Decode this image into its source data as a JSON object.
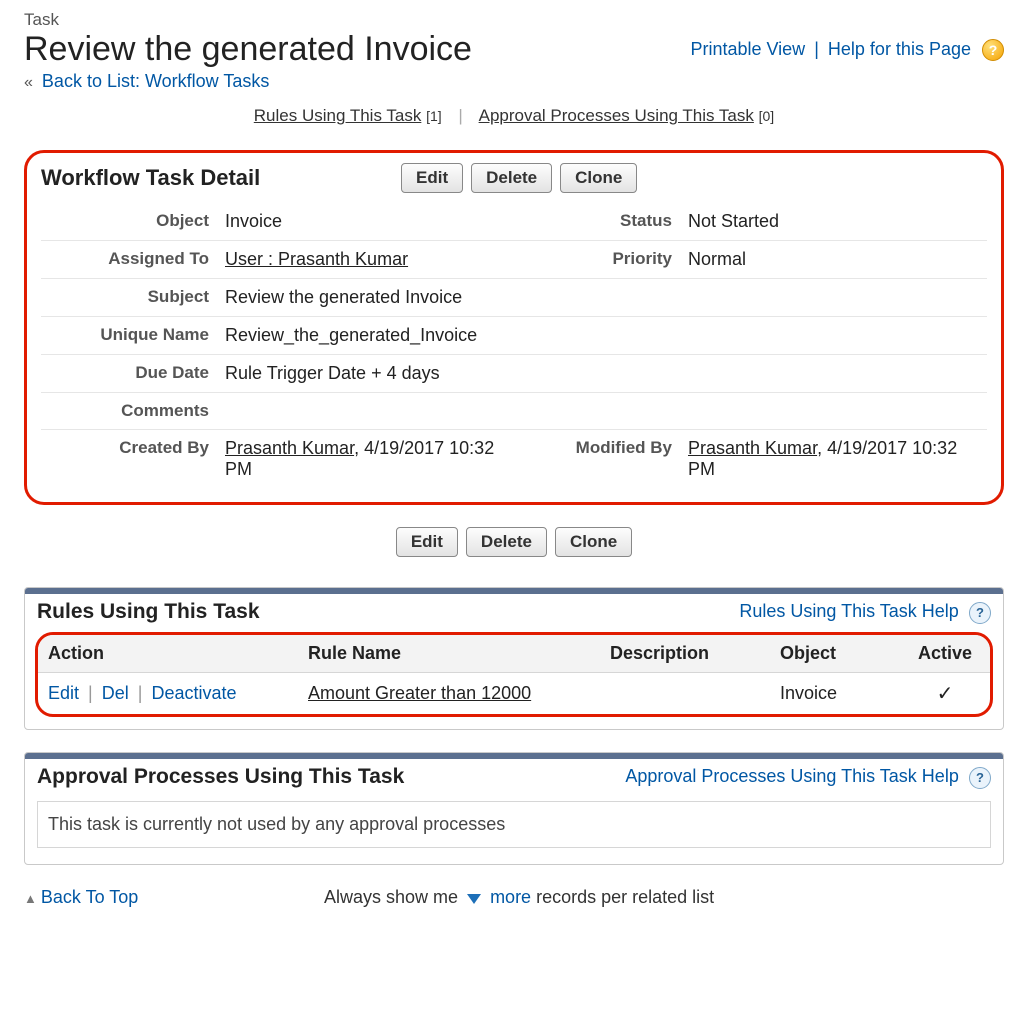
{
  "breadcrumb": {
    "label": "Task"
  },
  "page_title": "Review the generated Invoice",
  "top_links": {
    "printable": "Printable View",
    "help": "Help for this Page"
  },
  "back_link": {
    "text": "Back to List: Workflow Tasks"
  },
  "sub_links": {
    "rules": {
      "label": "Rules Using This Task",
      "count": "[1]"
    },
    "approvals": {
      "label": "Approval Processes Using This Task",
      "count": "[0]"
    }
  },
  "detail": {
    "title": "Workflow Task Detail",
    "buttons": {
      "edit": "Edit",
      "delete": "Delete",
      "clone": "Clone"
    },
    "fields": {
      "object_label": "Object",
      "object_value": "Invoice",
      "status_label": "Status",
      "status_value": "Not Started",
      "assigned_label": "Assigned To",
      "assigned_value": "User : Prasanth Kumar",
      "priority_label": "Priority",
      "priority_value": "Normal",
      "subject_label": "Subject",
      "subject_value": "Review the generated Invoice",
      "unique_label": "Unique Name",
      "unique_value": "Review_the_generated_Invoice",
      "due_label": "Due Date",
      "due_value": "Rule Trigger Date + 4 days",
      "comments_label": "Comments",
      "comments_value": "",
      "created_label": "Created By",
      "created_name": "Prasanth Kumar",
      "created_time": ", 4/19/2017 10:32 PM",
      "modified_label": "Modified By",
      "modified_name": "Prasanth Kumar",
      "modified_time": ", 4/19/2017 10:32 PM"
    }
  },
  "rules_panel": {
    "title": "Rules Using This Task",
    "help": "Rules Using This Task Help",
    "columns": {
      "action": "Action",
      "rule_name": "Rule Name",
      "description": "Description",
      "object": "Object",
      "active": "Active"
    },
    "row": {
      "edit": "Edit",
      "del": "Del",
      "deactivate": "Deactivate",
      "rule_name": "Amount Greater than 12000",
      "description": "",
      "object": "Invoice",
      "active_check": "✓"
    }
  },
  "approvals_panel": {
    "title": "Approval Processes Using This Task",
    "help": "Approval Processes Using This Task Help",
    "message": "This task is currently not used by any approval processes"
  },
  "footer": {
    "back_top": "Back To Top",
    "text_before": "Always show me ",
    "more": "more",
    "text_after": " records per related list"
  }
}
